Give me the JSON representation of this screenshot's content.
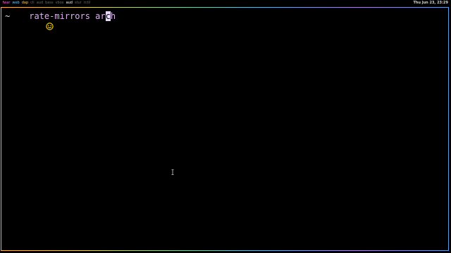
{
  "topbar": {
    "tags": [
      {
        "label": "fwar",
        "color": "#ff66cc"
      },
      {
        "label": "web",
        "color": "#66ccff"
      },
      {
        "label": "dap",
        "color": "#ffd24d"
      },
      {
        "label": "cli",
        "color": "#6a6a6a"
      },
      {
        "label": "aud",
        "color": "#6a6a6a"
      },
      {
        "label": "bass",
        "color": "#6a6a6a"
      },
      {
        "label": "vbox",
        "color": "#6a6a6a"
      },
      {
        "label": "aud",
        "color": "#ffffff"
      },
      {
        "label": "stur",
        "color": "#6a6a6a"
      },
      {
        "label": "rctil",
        "color": "#6a6a6a"
      }
    ],
    "clock": "Thu Jun 23, 23:29"
  },
  "terminal": {
    "prompt_symbol": "~",
    "command": "rate-mirrors",
    "argument_before_cursor": "ar",
    "cursor_char": "c",
    "argument_after_cursor": "h"
  },
  "icons": {
    "prompt_icon": "smiley-icon",
    "mouse_cursor": "text-ibeam-cursor-icon"
  }
}
